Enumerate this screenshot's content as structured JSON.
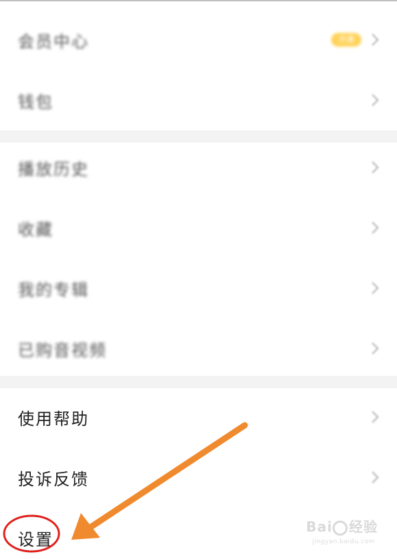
{
  "menu": {
    "section1": [
      {
        "label": "会员中心",
        "badge": "开通",
        "blurred": true
      },
      {
        "label": "钱包",
        "blurred": true
      }
    ],
    "section2": [
      {
        "label": "播放历史",
        "blurred": true
      },
      {
        "label": "收藏",
        "blurred": true
      },
      {
        "label": "我的专辑",
        "blurred": true
      },
      {
        "label": "已购音视频",
        "blurred": true
      }
    ],
    "section3": [
      {
        "label": "使用帮助",
        "blurred": false
      },
      {
        "label": "投诉反馈",
        "blurred": false
      },
      {
        "label": "设置",
        "blurred": false
      }
    ]
  },
  "annotation": {
    "arrow_color": "#f08a2e",
    "circle_color": "#e0201b"
  },
  "watermark": {
    "brand": "Bai",
    "brand_suffix": "经验",
    "sub": "jingyan.baidu.com"
  }
}
